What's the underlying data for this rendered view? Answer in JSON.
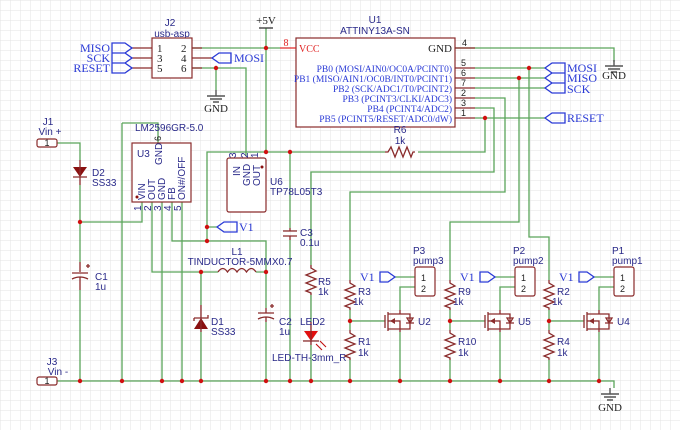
{
  "power": {
    "vcc": "+5V",
    "gnd": "GND"
  },
  "J2": {
    "ref": "J2",
    "value": "usb-asp",
    "pins_left": [
      "1",
      "3",
      "5"
    ],
    "pins_right": [
      "2",
      "4",
      "6"
    ],
    "left_labels": [
      "MISO",
      "SCK",
      "RESET"
    ],
    "right_label": "MOSI"
  },
  "U1": {
    "ref": "U1",
    "value": "ATTINY13A-SN",
    "vcc": "VCC",
    "vcc_pin": "8",
    "gnd": "GND",
    "gnd_pin": "4",
    "pins": [
      {
        "name": "PB0 (MOSI/AIN0/OC0A/PCINT0)",
        "num": "5"
      },
      {
        "name": "PB1 (MISO/AIN1/OC0B/INT0/PCINT1)",
        "num": "6"
      },
      {
        "name": "PB2 (SCK/ADC1/T0/PCINT2)",
        "num": "7"
      },
      {
        "name": "PB3 (PCINT3/CLKI/ADC3)",
        "num": "2"
      },
      {
        "name": "PB4 (PCINT4/ADC2)",
        "num": "3"
      },
      {
        "name": "PB5 (PCINT5/RESET/ADC0/dW)",
        "num": "1"
      }
    ],
    "labels": [
      "MOSI",
      "MISO",
      "SCK",
      "RESET"
    ]
  },
  "J1": {
    "ref": "J1",
    "value": "Vin +",
    "pin": "1"
  },
  "J3": {
    "ref": "J3",
    "value": "Vin -",
    "pin": "1"
  },
  "D2": {
    "ref": "D2",
    "value": "SS33"
  },
  "D1": {
    "ref": "D1",
    "value": "SS33"
  },
  "C1": {
    "ref": "C1",
    "value": "1u"
  },
  "C2": {
    "ref": "C2",
    "value": "1u"
  },
  "C3": {
    "ref": "C3",
    "value": "0.1u"
  },
  "L1": {
    "ref": "L1",
    "value": "TINDUCTOR-5MMX0.7"
  },
  "U3": {
    "ref": "U3",
    "value": "LM2596GR-5.0",
    "pins": [
      "VIN",
      "OUT",
      "GND",
      "FB",
      "ON#/OFF"
    ],
    "pin_nums": [
      "1",
      "2",
      "3",
      "4",
      "5"
    ],
    "top_pin": "GND",
    "top_num": "6"
  },
  "U6": {
    "ref": "U6",
    "value": "TP78L05T3",
    "pins": [
      "IN",
      "GND",
      "OUT"
    ],
    "pin_nums": [
      "3",
      "2",
      "1"
    ]
  },
  "R6": {
    "ref": "R6",
    "value": "1k"
  },
  "R5": {
    "ref": "R5",
    "value": "1k"
  },
  "LED2": {
    "ref": "LED2",
    "value": "LED-TH-3mm_R"
  },
  "v1": "V1",
  "channels": [
    {
      "rtop": "R3",
      "rtop_val": "1k",
      "rbot": "R1",
      "rbot_val": "1k",
      "fet": "U2",
      "conn": "P3",
      "conn_val": "pump3"
    },
    {
      "rtop": "R9",
      "rtop_val": "1k",
      "rbot": "R10",
      "rbot_val": "1k",
      "fet": "U5",
      "conn": "P2",
      "conn_val": "pump2"
    },
    {
      "rtop": "R2",
      "rtop_val": "1k",
      "rbot": "R4",
      "rbot_val": "1k",
      "fet": "U4",
      "conn": "P1",
      "conn_val": "pump1"
    }
  ],
  "conn_pins": [
    "1",
    "2"
  ],
  "colors": {
    "wire": "#5aa55a",
    "component": "#8a2b2b",
    "label": "#2a3ad6",
    "junction": "#d01010",
    "power_pin": "#e02020"
  }
}
